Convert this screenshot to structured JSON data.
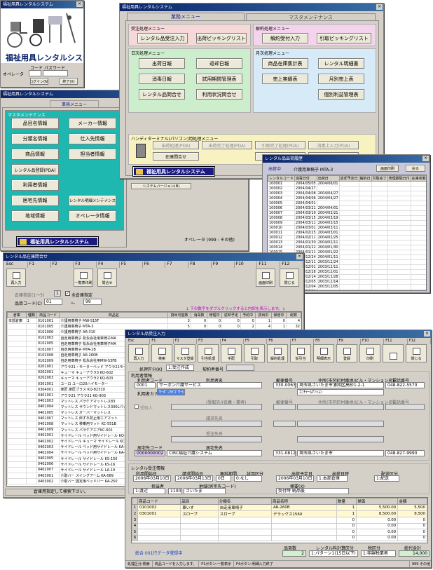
{
  "login": {
    "title": "福祉用具レンタルシステム",
    "app_name": "福祉用具レンタルシステム",
    "operator_label": "オペレータ",
    "code_label": "コード",
    "password_label": "パスワード",
    "login_button": "ログイン(N)",
    "exit_button": "終了(X)"
  },
  "main_menu": {
    "title": "福祉用具レンタルシステム",
    "tabs": [
      "業務メニュー",
      "マスタメンテナンス"
    ],
    "order_section": "受注処理メニュー",
    "order_buttons": [
      "レンタル品受注入力",
      "出荷ピッキングリスト"
    ],
    "cancel_section": "解約処理メニュー",
    "cancel_buttons": [
      "解約受付入力",
      "引取ピッキングリスト"
    ],
    "daily_section": "日次処理メニュー",
    "daily_buttons": [
      "出荷日報",
      "返却日報",
      "消毒日報",
      "試用期間管理表",
      "レンタル品問合せ",
      "利用状況問合せ"
    ],
    "monthly_section": "月次処理メニュー",
    "monthly_buttons": [
      "商品在庫集計表",
      "レンタル明細書",
      "売上実績表",
      "月別売上表",
      "個別利益管理表"
    ],
    "handy_section": "ハンディターミナル(パソコン)用処理メニュー",
    "handy_buttons": [
      "出荷処理(PDA)",
      "出荷完了処理(PDA)",
      "引取完了処理(PDA)",
      "消毒上入力(PDA)",
      "在庫問合せ",
      "トラブル処理(PDA)",
      "廃棄処理(PDA)"
    ],
    "logo": "福祉用具レンタルシステム"
  },
  "master_menu": {
    "title": "福祉用具レンタルシステム",
    "tab": "業務メニュー",
    "section": "マスタメンテナンス",
    "buttons": [
      "品目名情報",
      "メーカー情報",
      "分類名情報",
      "仕入先情報",
      "商品情報",
      "担当者情報",
      "レンタル品登録(PDA)",
      "",
      "利用者情報",
      "",
      "居宅先情報",
      "レンタル明細メンテナンス",
      "地域情報",
      "オペレータ情報"
    ],
    "version": "システムバージョン(N)",
    "logo": "福祉用具レンタルシステム",
    "operator": "オペレータ (999 : その他)"
  },
  "history": {
    "title": "レンタル品出荷履歴",
    "header_label": "出荷中",
    "item": "介護用車椅子 MTA-3",
    "print_button": "画面印刷",
    "back_button": "戻る",
    "columns": [
      "レンタルコード",
      "消毒日付",
      "出荷日",
      "返却予定日",
      "解約日",
      "引取完了",
      "修理期間日付",
      "在庫状態"
    ],
    "rows": [
      [
        "100001",
        "2004/05/05",
        "2004/06/01"
      ],
      [
        "100002",
        "2004/04/27",
        ""
      ],
      [
        "100003",
        "2004/04/08",
        "2004/04/27"
      ],
      [
        "100004",
        "2004/04/06",
        "2004/04/27"
      ],
      [
        "100005",
        "2004/04/01",
        ""
      ],
      [
        "100006",
        "2004/03/21",
        "2004/04/01"
      ],
      [
        "100007",
        "2004/03/19",
        "2004/03/21"
      ],
      [
        "100008",
        "2004/03/15",
        "2004/03/19"
      ],
      [
        "100009",
        "2004/03/11",
        "2004/03/15"
      ],
      [
        "100010",
        "2004/03/01",
        "2004/03/11"
      ],
      [
        "100011",
        "2004/02/25",
        "2004/03/01"
      ],
      [
        "100012",
        "2004/02/11",
        "2004/02/25"
      ],
      [
        "100013",
        "2004/01/30",
        "2004/02/11"
      ],
      [
        "100014",
        "2004/01/22",
        "2004/01/30"
      ],
      [
        "100015",
        "2004/01/11",
        "2004/01/22"
      ],
      [
        "100016",
        "2003/12/24",
        "2004/01/11"
      ],
      [
        "100017",
        "2003/12/11",
        "2003/12/24"
      ],
      [
        "100018",
        "2003/12/01",
        "2003/12/11"
      ],
      [
        "100019",
        "2003/12/28",
        "2003/12/01"
      ],
      [
        "100020",
        "2003/12/14",
        "2003/12/28"
      ],
      [
        "100021",
        "2003/12/05",
        "2003/12/14"
      ],
      [
        "100022",
        "2003/12/04",
        "2003/12/05"
      ],
      [
        "100023",
        "2003/12/24",
        ""
      ]
    ]
  },
  "inventory": {
    "title": "レンタル品在庫問合せ",
    "fkeys": [
      "Esc",
      "F1",
      "F2",
      "F3",
      "F4",
      "F5",
      "F6",
      "F7",
      "F8",
      "F9",
      "F10",
      "F11",
      "F12"
    ],
    "tools": [
      "再入力",
      "一覧表印刷",
      "問合せ",
      "画面印刷",
      "閉じる"
    ],
    "store_label": "倉庫指定(1～5)",
    "store_value": "1",
    "store_check": "全倉庫指定",
    "code_label": "品目コード(C)",
    "code_from": "01",
    "code_to": "99",
    "hint": "↓ 下の数字をダブルクリックすると内訳を表示します。↓",
    "columns": [
      "倉庫",
      "種類",
      "商品コード",
      "商品名",
      "貸出可能数",
      "消毒数",
      "修理中",
      "返却予定",
      "予約中",
      "貸出中",
      "保管中",
      "総数"
    ],
    "rows": [
      [
        "本部倉庫",
        "1",
        "0101001",
        "介護用車椅子 MW-S15F",
        "3",
        "0",
        "0",
        "0",
        "0",
        "1",
        "0",
        "4"
      ],
      [
        "",
        "",
        "0101005",
        "介護用車椅子 MTA-3",
        "5",
        "0",
        "0",
        "0",
        "2",
        "4",
        "1",
        "32"
      ],
      [
        "",
        "",
        "0101006",
        "介護用車椅子 AR-310",
        "",
        "",
        "",
        "",
        "",
        "",
        "",
        ""
      ],
      [
        "",
        "",
        "0102003",
        "自走用車椅子 松永会社用車椅子MA",
        "",
        "",
        "",
        "",
        "",
        "",
        "",
        ""
      ],
      [
        "",
        "",
        "0102005",
        "自走用車椅子 松永会社用車椅子MA",
        "",
        "",
        "",
        "",
        "",
        "",
        "",
        ""
      ],
      [
        "",
        "",
        "0102007",
        "自走用車椅子 MTA-2B",
        "",
        "",
        "",
        "",
        "",
        "",
        "",
        ""
      ],
      [
        "",
        "",
        "0102008",
        "自走用車椅子 AR-260B",
        "",
        "",
        "",
        "",
        "",
        "",
        "",
        ""
      ],
      [
        "",
        "",
        "0102009",
        "自走用車椅子 松永会社用MW-S3FB",
        "",
        "",
        "",
        "",
        "",
        "",
        "",
        ""
      ],
      [
        "",
        "",
        "0201001",
        "アウラ21・モーターベッド アウラ21モーターベッド KQ-",
        "",
        "",
        "",
        "",
        "",
        "",
        "",
        ""
      ],
      [
        "",
        "",
        "0202001",
        "キューマ キューアウラ3 KQ-602",
        "",
        "",
        "",
        "",
        "",
        "",
        "",
        ""
      ],
      [
        "",
        "",
        "0202003",
        "キューマ キューアウラ2 KQ-603",
        "",
        "",
        "",
        "",
        "",
        "",
        "",
        ""
      ],
      [
        "",
        "",
        "0301001",
        "ユーロ ユーロ20ハイモーター",
        "",
        "",
        "",
        "",
        "",
        "",
        "",
        ""
      ],
      [
        "",
        "",
        "0304001",
        "楽匠 楽匠プラス KQ-8231D",
        "",
        "",
        "",
        "",
        "",
        "",
        "",
        ""
      ],
      [
        "",
        "",
        "0401001",
        "アウラ21 アウラ21 KQ-903",
        "",
        "",
        "",
        "",
        "",
        "",
        "",
        ""
      ],
      [
        "",
        "",
        "0401003",
        "マットレス パラケアマットレス83",
        "",
        "",
        "",
        "",
        "",
        "",
        "",
        ""
      ],
      [
        "",
        "",
        "0401004",
        "マットレス サウンドマットレス300Lパッセー",
        "",
        "",
        "",
        "",
        "",
        "",
        "",
        ""
      ],
      [
        "",
        "",
        "0401005",
        "マットレス オーバーマットレス",
        "",
        "",
        "",
        "",
        "",
        "",
        "",
        ""
      ],
      [
        "",
        "",
        "0401007",
        "マットレス 床ずれ防止用エアマット",
        "",
        "",
        "",
        "",
        "",
        "",
        "",
        ""
      ],
      [
        "",
        "",
        "0401008",
        "マットレス 移乗用マット KC-551B",
        "",
        "",
        "",
        "",
        "",
        "",
        "",
        ""
      ],
      [
        "",
        "",
        "0401009",
        "マットレス パラケアエアKC-601",
        "",
        "",
        "",
        "",
        "",
        "",
        "",
        ""
      ],
      [
        "",
        "",
        "0402001",
        "サイドレール ベッド用サイドレール KQ-016",
        "",
        "",
        "",
        "",
        "",
        "",
        "",
        ""
      ],
      [
        "",
        "",
        "0402002",
        "サイドレール キューマ サイドレール KC-121",
        "",
        "",
        "",
        "",
        "",
        "",
        "",
        ""
      ],
      [
        "",
        "",
        "0402003",
        "サイドレール ベッド用サイドレール KA-121",
        "",
        "",
        "",
        "",
        "",
        "",
        "",
        ""
      ],
      [
        "",
        "",
        "0402004",
        "サイドレール ベッド用サイドレール KA-120",
        "",
        "",
        "",
        "",
        "",
        "",
        "",
        ""
      ],
      [
        "",
        "",
        "0402005",
        "サイドレール サイドレール KS-150",
        "",
        "",
        "",
        "",
        "",
        "",
        "",
        ""
      ],
      [
        "",
        "",
        "0402006",
        "サイドレール サイドレール KS-16",
        "",
        "",
        "",
        "",
        "",
        "",
        "",
        ""
      ],
      [
        "",
        "",
        "0402007",
        "サイドレール サイドレール LA-19",
        "",
        "",
        "",
        "",
        "",
        "",
        "",
        ""
      ],
      [
        "",
        "",
        "0403001",
        "介助バー スイングアーム KA-089",
        "",
        "",
        "",
        "",
        "",
        "",
        "",
        ""
      ],
      [
        "",
        "",
        "0403002",
        "介助バー 固定用ベッドバー KA-250",
        "",
        "",
        "",
        "",
        "",
        "",
        "",
        ""
      ]
    ],
    "status": "倉庫用指定して検索下さい。"
  },
  "order": {
    "title": "レンタル品受注入力",
    "fkeys": [
      "Esc",
      "F1",
      "F2",
      "F3",
      "F4",
      "F5",
      "F6",
      "F7",
      "F8",
      "F9",
      "F10",
      "F11",
      "F12"
    ],
    "tools": [
      "再入力",
      "検索",
      "マスタ登録",
      "引当処理",
      "手配",
      "引取",
      "解約処理",
      "仮引当",
      "明細表示",
      "登録",
      "印刷",
      "",
      "閉じる"
    ],
    "type_label": "処理区分(K)",
    "type_value": "1:受注作成",
    "contract_label": "契約者番号",
    "user_section": "利用者情報",
    "user_code_label": "利用者コード",
    "user_code": "0001",
    "user_name_label": "利用者名",
    "user_name": "サーボン介護サービス",
    "user_kana_label": "利用者カナ",
    "user_kana": "ｻｰﾎﾞﾝｶｲｺﾞｻｰﾋﾞｽ",
    "zip_label": "郵便番号",
    "zip": "330-0063",
    "addr_label": "住所(市区町村番地/ビル・マンション名)",
    "addr": "埼玉県さいたま市浦和区高砂1-2-1",
    "addr2": "ﾕﾆﾁｬｰﾑﾏﾝｼｮﾝ",
    "tel_label": "電話番号",
    "tel": "048-822-5570",
    "sel_label": "受取人",
    "sel_row": [
      "(受取先)(名義・業者)",
      "郵便番号",
      "住所(市区町村番地/ビル・マンション名)",
      "電話番号"
    ],
    "shipto_label": "請求先名",
    "order_from_label": "受注先名",
    "dealer_label": "居宅先コード",
    "dealer_code": "0000000002",
    "dealer_name_label": "居宅先名",
    "dealer_name": "CIRC福祉介護システム",
    "dealer_zip": "331-0812",
    "dealer_addr": "埼玉県さいたま市",
    "dealer_tel": "048-827-9990",
    "rental_section": "レンタル受注情報",
    "rent_date_label": "利用開始日",
    "rent_date": "2006年03月10日",
    "bill_date_label": "請求開始日",
    "bill_date": "2006年03月13日",
    "free_label": "無料期間",
    "free": "0日",
    "trial_label": "試用区分",
    "trial": "0:なし",
    "ship_date_label": "出荷予定日",
    "ship_date": "2006年03月10日",
    "method_label": "出荷日時",
    "method": "1:本部倉庫",
    "deliv_label": "配送区分",
    "deliv": "1:配送",
    "staff_label": "担当者",
    "staff": "1:渡辺",
    "area_label": "地域(居宅先コード)",
    "area": "さいたま",
    "area_code": "11005",
    "memo_label": "摘要(X)",
    "memo": "受付時 納品後",
    "line_columns": [
      "商品コード",
      "品目",
      "分類名",
      "商品名称",
      "数量",
      "単価",
      "金額"
    ],
    "lines": [
      [
        "0101002",
        "車いす",
        "自走用車椅子",
        "AR-260B",
        "1",
        "5,500.00",
        "5,500"
      ],
      [
        "0301001",
        "スロープ",
        "スロープ",
        "デラックス1560",
        "1",
        "8,500.00",
        "8,500"
      ],
      [
        "",
        "",
        "",
        "",
        "0",
        "0.00",
        "0"
      ],
      [
        "",
        "",
        "",
        "",
        "0",
        "0.00",
        "0"
      ],
      [
        "",
        "",
        "",
        "",
        "0",
        "0.00",
        "0"
      ],
      [
        "",
        "",
        "",
        "",
        "0",
        "0.00",
        "0"
      ]
    ],
    "note": "総合 001行データ登録中",
    "count_label": "品目数",
    "count": "2",
    "calc_label": "レンタル料計算区分",
    "calc": "1:パターン1(15日以下)",
    "tax_label": "税区分",
    "tax": "1:非課税業者",
    "total_label": "総代金計",
    "total": "14,000",
    "status": [
      "処理区分:検索",
      "商品コードを入力します。",
      "F1ボタン:一覧表示",
      "F4ボタン:明細入力終了"
    ],
    "status_right": "999 その他"
  }
}
